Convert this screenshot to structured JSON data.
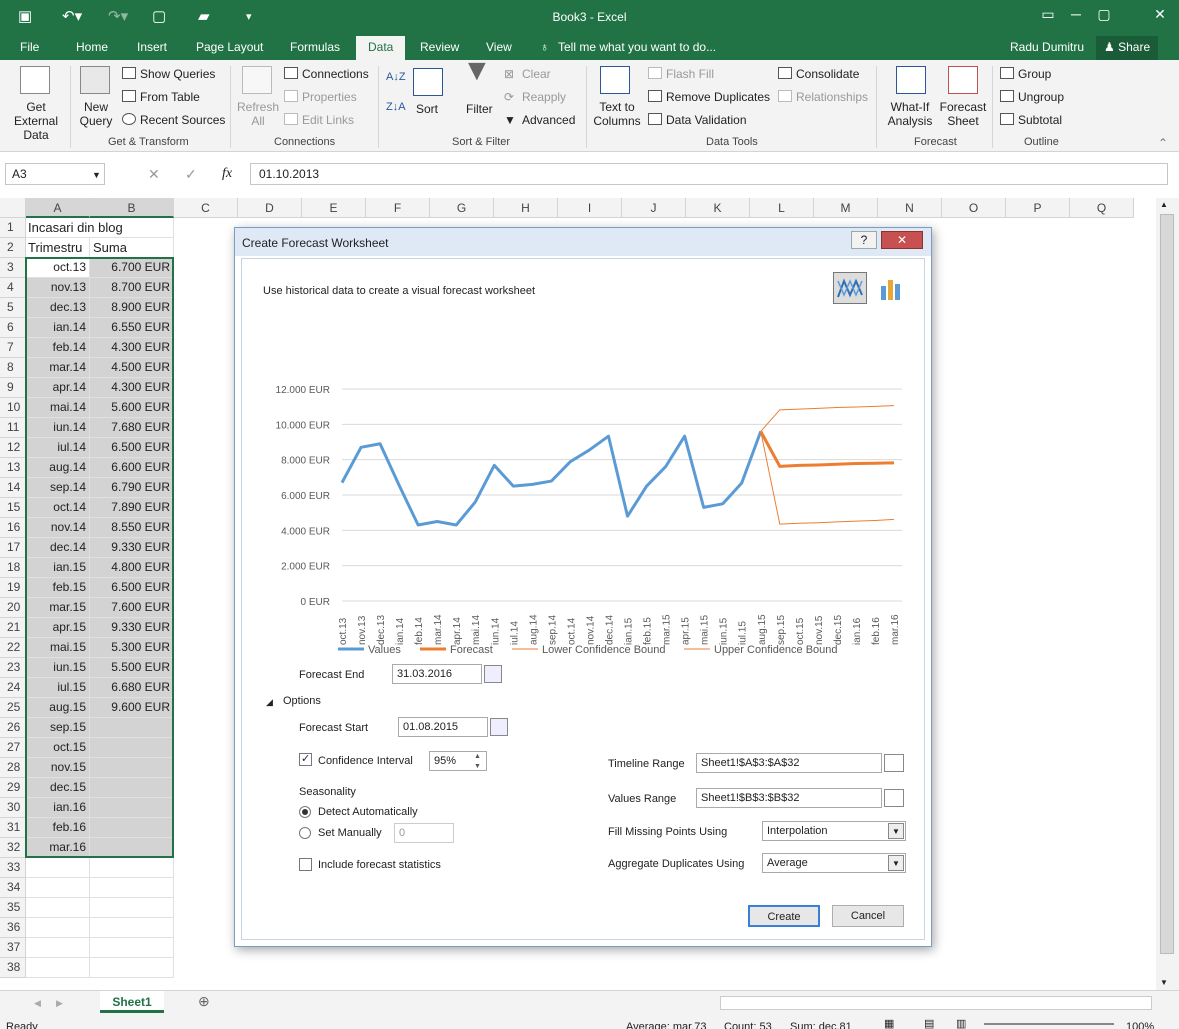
{
  "app": {
    "title": "Book3 - Excel",
    "user": "Radu Dumitru",
    "share": "Share"
  },
  "tabs": [
    "File",
    "Home",
    "Insert",
    "Page Layout",
    "Formulas",
    "Data",
    "Review",
    "View"
  ],
  "tell_me": "Tell me what you want to do...",
  "ribbon": {
    "get_external_data": "Get External Data",
    "new_query": "New Query",
    "show_queries": "Show Queries",
    "from_table": "From Table",
    "recent_sources": "Recent Sources",
    "group_get_transform": "Get & Transform",
    "refresh_all": "Refresh All",
    "connections": "Connections",
    "properties": "Properties",
    "edit_links": "Edit Links",
    "group_connections": "Connections",
    "sort": "Sort",
    "filter": "Filter",
    "clear": "Clear",
    "reapply": "Reapply",
    "advanced": "Advanced",
    "group_sort_filter": "Sort & Filter",
    "text_to_columns": "Text to Columns",
    "flash_fill": "Flash Fill",
    "remove_duplicates": "Remove Duplicates",
    "data_validation": "Data Validation",
    "consolidate": "Consolidate",
    "relationships": "Relationships",
    "group_data_tools": "Data Tools",
    "what_if": "What-If Analysis",
    "forecast_sheet": "Forecast Sheet",
    "group_forecast": "Forecast",
    "group": "Group",
    "ungroup": "Ungroup",
    "subtotal": "Subtotal",
    "group_outline": "Outline"
  },
  "formula_bar": {
    "name_box": "A3",
    "formula": "01.10.2013"
  },
  "columns": [
    "A",
    "B",
    "C",
    "D",
    "E",
    "F",
    "G",
    "H",
    "I",
    "J",
    "K",
    "L",
    "M",
    "N",
    "O",
    "P",
    "Q"
  ],
  "rows": [
    {
      "n": "1",
      "a": "Incasari din blog",
      "b": ""
    },
    {
      "n": "2",
      "a": "Trimestru",
      "b": "Suma"
    },
    {
      "n": "3",
      "a": "oct.13",
      "b": "6.700 EUR"
    },
    {
      "n": "4",
      "a": "nov.13",
      "b": "8.700 EUR"
    },
    {
      "n": "5",
      "a": "dec.13",
      "b": "8.900 EUR"
    },
    {
      "n": "6",
      "a": "ian.14",
      "b": "6.550 EUR"
    },
    {
      "n": "7",
      "a": "feb.14",
      "b": "4.300 EUR"
    },
    {
      "n": "8",
      "a": "mar.14",
      "b": "4.500 EUR"
    },
    {
      "n": "9",
      "a": "apr.14",
      "b": "4.300 EUR"
    },
    {
      "n": "10",
      "a": "mai.14",
      "b": "5.600 EUR"
    },
    {
      "n": "11",
      "a": "iun.14",
      "b": "7.680 EUR"
    },
    {
      "n": "12",
      "a": "iul.14",
      "b": "6.500 EUR"
    },
    {
      "n": "13",
      "a": "aug.14",
      "b": "6.600 EUR"
    },
    {
      "n": "14",
      "a": "sep.14",
      "b": "6.790 EUR"
    },
    {
      "n": "15",
      "a": "oct.14",
      "b": "7.890 EUR"
    },
    {
      "n": "16",
      "a": "nov.14",
      "b": "8.550 EUR"
    },
    {
      "n": "17",
      "a": "dec.14",
      "b": "9.330 EUR"
    },
    {
      "n": "18",
      "a": "ian.15",
      "b": "4.800 EUR"
    },
    {
      "n": "19",
      "a": "feb.15",
      "b": "6.500 EUR"
    },
    {
      "n": "20",
      "a": "mar.15",
      "b": "7.600 EUR"
    },
    {
      "n": "21",
      "a": "apr.15",
      "b": "9.330 EUR"
    },
    {
      "n": "22",
      "a": "mai.15",
      "b": "5.300 EUR"
    },
    {
      "n": "23",
      "a": "iun.15",
      "b": "5.500 EUR"
    },
    {
      "n": "24",
      "a": "iul.15",
      "b": "6.680 EUR"
    },
    {
      "n": "25",
      "a": "aug.15",
      "b": "9.600 EUR"
    },
    {
      "n": "26",
      "a": "sep.15",
      "b": ""
    },
    {
      "n": "27",
      "a": "oct.15",
      "b": ""
    },
    {
      "n": "28",
      "a": "nov.15",
      "b": ""
    },
    {
      "n": "29",
      "a": "dec.15",
      "b": ""
    },
    {
      "n": "30",
      "a": "ian.16",
      "b": ""
    },
    {
      "n": "31",
      "a": "feb.16",
      "b": ""
    },
    {
      "n": "32",
      "a": "mar.16",
      "b": ""
    },
    {
      "n": "33",
      "a": "",
      "b": ""
    },
    {
      "n": "34",
      "a": "",
      "b": ""
    },
    {
      "n": "35",
      "a": "",
      "b": ""
    },
    {
      "n": "36",
      "a": "",
      "b": ""
    },
    {
      "n": "37",
      "a": "",
      "b": ""
    },
    {
      "n": "38",
      "a": "",
      "b": ""
    }
  ],
  "sheet_tab": "Sheet1",
  "status": {
    "ready": "Ready",
    "average": "Average: mar.73",
    "count": "Count: 53",
    "sum": "Sum: dec.81",
    "zoom": "100%"
  },
  "dialog": {
    "title": "Create Forecast Worksheet",
    "help": "?",
    "close": "✕",
    "description": "Use historical data to create a visual forecast worksheet",
    "forecast_end_label": "Forecast End",
    "forecast_end": "31.03.2016",
    "options": "Options",
    "forecast_start_label": "Forecast Start",
    "forecast_start": "01.08.2015",
    "confidence_label": "Confidence Interval",
    "confidence": "95%",
    "seasonality": "Seasonality",
    "detect_auto": "Detect Automatically",
    "set_manually": "Set Manually",
    "manual_value": "0",
    "include_stats": "Include forecast statistics",
    "timeline_label": "Timeline Range",
    "timeline": "Sheet1!$A$3:$A$32",
    "values_label": "Values Range",
    "values": "Sheet1!$B$3:$B$32",
    "fill_missing_label": "Fill Missing Points Using",
    "fill_missing": "Interpolation",
    "aggregate_label": "Aggregate Duplicates Using",
    "aggregate": "Average",
    "create": "Create",
    "cancel": "Cancel"
  },
  "chart_data": {
    "type": "line",
    "categories": [
      "oct.13",
      "nov.13",
      "dec.13",
      "ian.14",
      "feb.14",
      "mar.14",
      "apr.14",
      "mai.14",
      "iun.14",
      "iul.14",
      "aug.14",
      "sep.14",
      "oct.14",
      "nov.14",
      "dec.14",
      "ian.15",
      "feb.15",
      "mar.15",
      "apr.15",
      "mai.15",
      "iun.15",
      "iul.15",
      "aug.15",
      "sep.15",
      "oct.15",
      "nov.15",
      "dec.15",
      "ian.16",
      "feb.16",
      "mar.16"
    ],
    "yticks": [
      "0 EUR",
      "2.000 EUR",
      "4.000 EUR",
      "6.000 EUR",
      "8.000 EUR",
      "10.000 EUR",
      "12.000 EUR"
    ],
    "ylim": [
      0,
      12000
    ],
    "grid": true,
    "legend_position": "bottom",
    "series": [
      {
        "name": "Values",
        "color": "#5b9bd5",
        "values": [
          6700,
          8700,
          8900,
          6550,
          4300,
          4500,
          4300,
          5600,
          7680,
          6500,
          6600,
          6790,
          7890,
          8550,
          9330,
          4800,
          6500,
          7600,
          9330,
          5300,
          5500,
          6680,
          9600,
          null,
          null,
          null,
          null,
          null,
          null,
          null
        ]
      },
      {
        "name": "Forecast",
        "color": "#ed7d31",
        "values": [
          null,
          null,
          null,
          null,
          null,
          null,
          null,
          null,
          null,
          null,
          null,
          null,
          null,
          null,
          null,
          null,
          null,
          null,
          null,
          null,
          null,
          null,
          9600,
          7620,
          7680,
          7700,
          7740,
          7780,
          7800,
          7820
        ]
      },
      {
        "name": "Lower Confidence Bound",
        "color": "#ed7d31",
        "values": [
          null,
          null,
          null,
          null,
          null,
          null,
          null,
          null,
          null,
          null,
          null,
          null,
          null,
          null,
          null,
          null,
          null,
          null,
          null,
          null,
          null,
          null,
          9600,
          4350,
          4400,
          4430,
          4480,
          4520,
          4560,
          4620
        ]
      },
      {
        "name": "Upper Confidence Bound",
        "color": "#ed7d31",
        "values": [
          null,
          null,
          null,
          null,
          null,
          null,
          null,
          null,
          null,
          null,
          null,
          null,
          null,
          null,
          null,
          null,
          null,
          null,
          null,
          null,
          null,
          null,
          9600,
          10820,
          10860,
          10900,
          10950,
          10980,
          11020,
          11060
        ]
      }
    ]
  }
}
